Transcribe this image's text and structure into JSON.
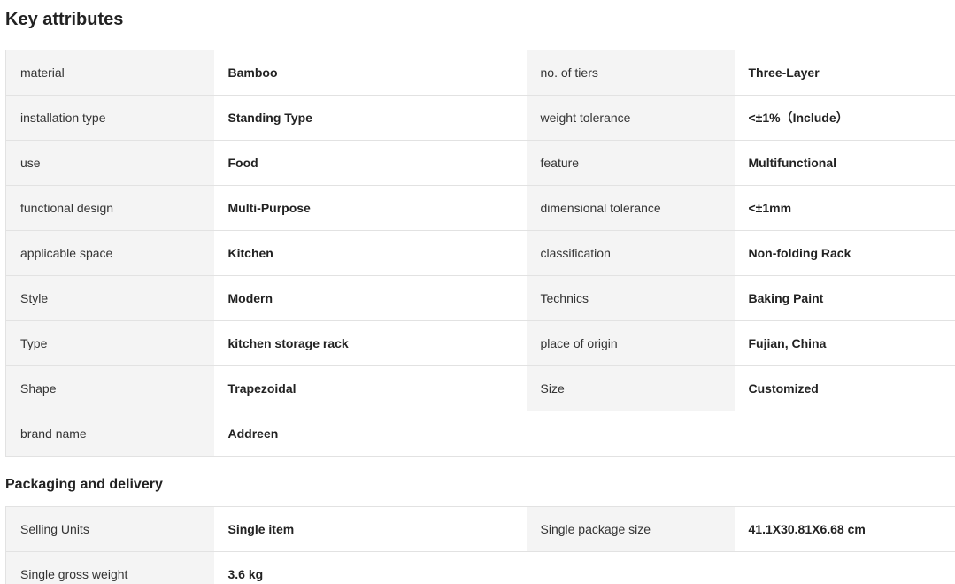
{
  "key_attributes": {
    "title": "Key attributes",
    "rows": [
      {
        "k1": "material",
        "v1": "Bamboo",
        "k2": "no. of tiers",
        "v2": "Three-Layer"
      },
      {
        "k1": "installation type",
        "v1": "Standing Type",
        "k2": "weight tolerance",
        "v2": "<±1%（Include）"
      },
      {
        "k1": "use",
        "v1": "Food",
        "k2": "feature",
        "v2": "Multifunctional"
      },
      {
        "k1": "functional design",
        "v1": "Multi-Purpose",
        "k2": "dimensional tolerance",
        "v2": "<±1mm"
      },
      {
        "k1": "applicable space",
        "v1": "Kitchen",
        "k2": "classification",
        "v2": "Non-folding Rack"
      },
      {
        "k1": "Style",
        "v1": "Modern",
        "k2": "Technics",
        "v2": "Baking Paint"
      },
      {
        "k1": "Type",
        "v1": "kitchen storage rack",
        "k2": "place of origin",
        "v2": "Fujian, China"
      },
      {
        "k1": "Shape",
        "v1": "Trapezoidal",
        "k2": "Size",
        "v2": "Customized"
      },
      {
        "k1": "brand name",
        "v1": "Addreen"
      }
    ]
  },
  "packaging": {
    "title": "Packaging and delivery",
    "rows": [
      {
        "k1": "Selling Units",
        "v1": "Single item",
        "k2": "Single package size",
        "v2": "41.1X30.81X6.68 cm"
      },
      {
        "k1": "Single gross weight",
        "v1": "3.6 kg"
      }
    ]
  }
}
